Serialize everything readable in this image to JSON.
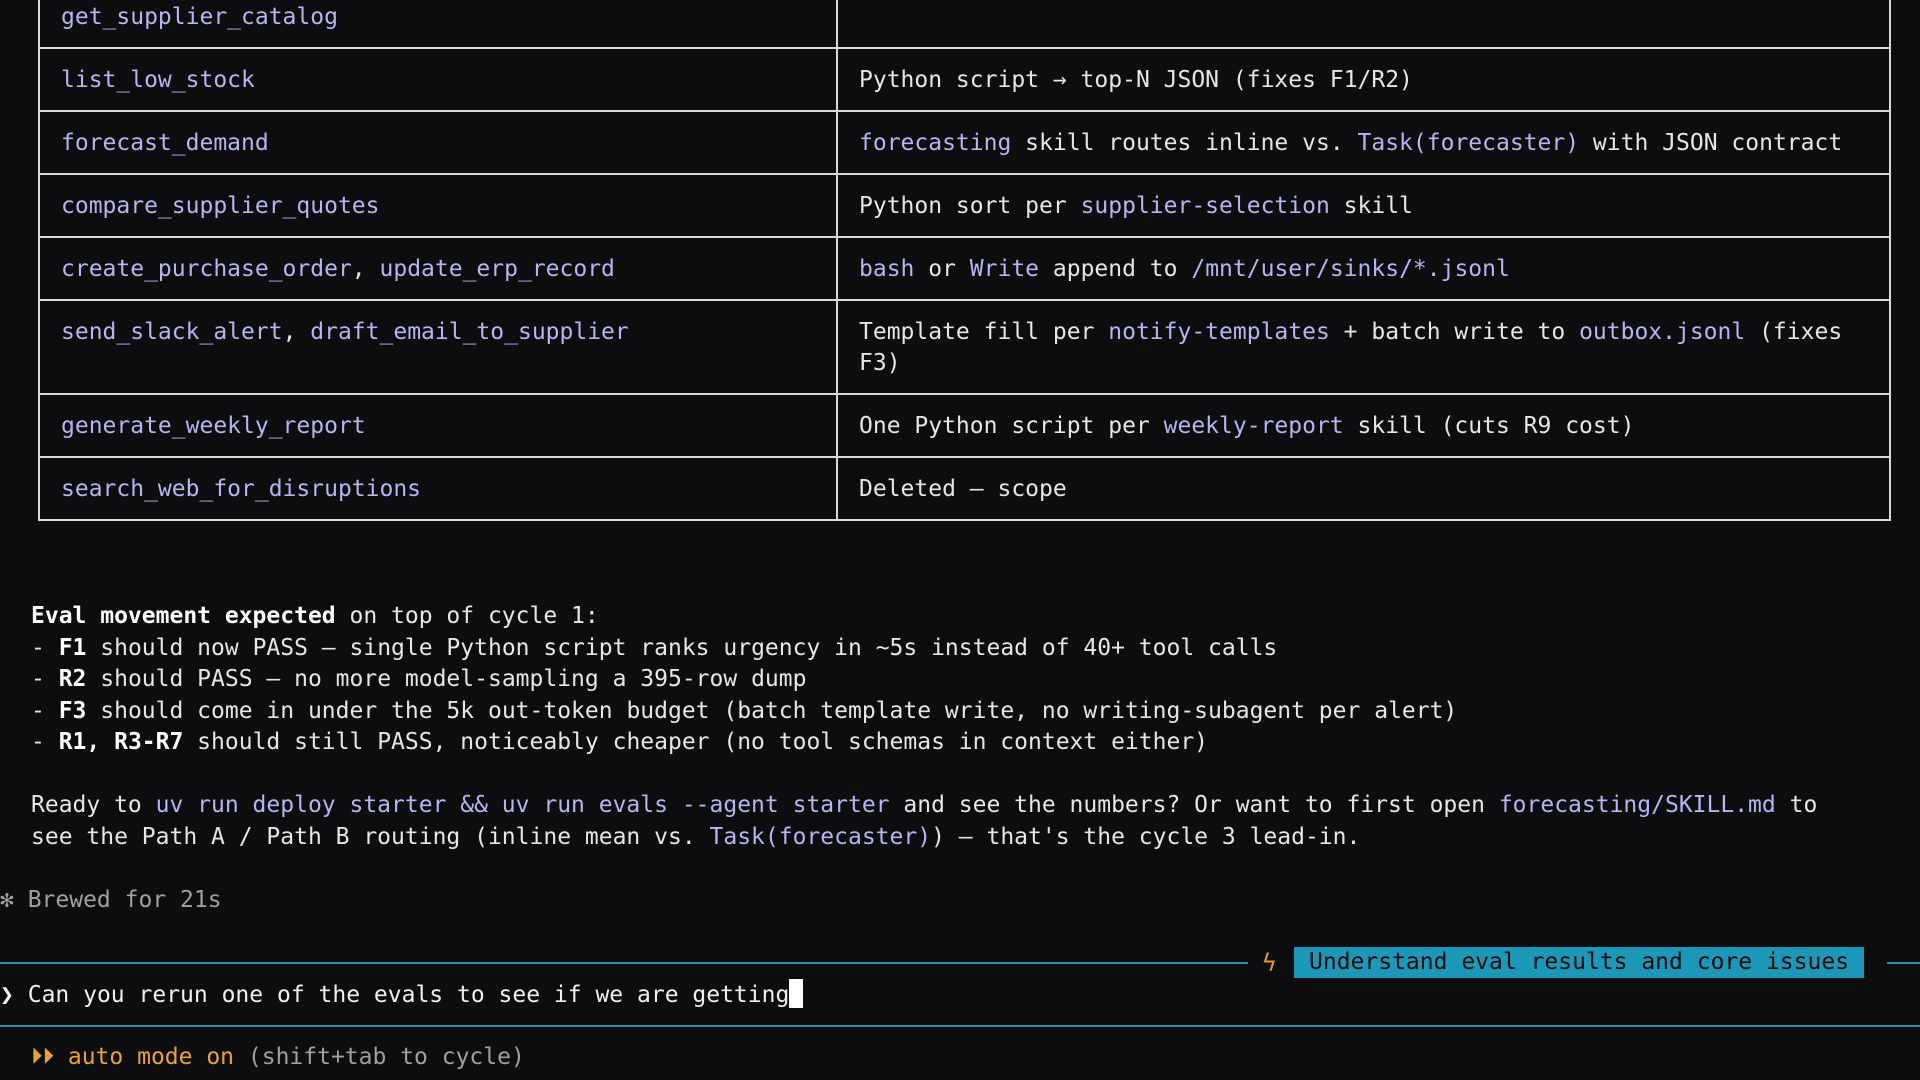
{
  "table": {
    "rows": [
      {
        "tools": [
          "get_supplier_catalog"
        ],
        "replacement": []
      },
      {
        "tools": [
          "list_low_stock"
        ],
        "replacement": [
          {
            "t": "Python script → top-N JSON (fixes F1/R2)"
          }
        ]
      },
      {
        "tools": [
          "forecast_demand"
        ],
        "replacement": [
          {
            "t": "forecasting",
            "code": true
          },
          {
            "t": " skill routes inline vs. "
          },
          {
            "t": "Task(forecaster)",
            "code": true
          },
          {
            "t": " with JSON contract"
          }
        ]
      },
      {
        "tools": [
          "compare_supplier_quotes"
        ],
        "replacement": [
          {
            "t": "Python sort per "
          },
          {
            "t": "supplier-selection",
            "code": true
          },
          {
            "t": " skill"
          }
        ]
      },
      {
        "tools": [
          "create_purchase_order",
          "update_erp_record"
        ],
        "replacement": [
          {
            "t": "bash",
            "code": true
          },
          {
            "t": " or "
          },
          {
            "t": "Write",
            "code": true
          },
          {
            "t": " append to "
          },
          {
            "t": "/mnt/user/sinks/*.jsonl",
            "code": true
          }
        ]
      },
      {
        "tools": [
          "send_slack_alert",
          "draft_email_to_supplier"
        ],
        "replacement": [
          {
            "t": "Template fill per "
          },
          {
            "t": "notify-templates",
            "code": true
          },
          {
            "t": " + batch write to "
          },
          {
            "t": "outbox.jsonl",
            "code": true
          },
          {
            "t": " (fixes F3)"
          }
        ]
      },
      {
        "tools": [
          "generate_weekly_report"
        ],
        "replacement": [
          {
            "t": "One Python script per "
          },
          {
            "t": "weekly-report",
            "code": true
          },
          {
            "t": " skill (cuts R9 cost)"
          }
        ]
      },
      {
        "tools": [
          "search_web_for_disruptions"
        ],
        "replacement": [
          {
            "t": "Deleted — scope"
          }
        ]
      }
    ]
  },
  "eval": {
    "heading_bold": "Eval movement expected",
    "heading_rest": " on top of cycle 1:",
    "items": [
      {
        "id": "F1",
        "text": " should now PASS — single Python script ranks urgency in ~5s instead of 40+ tool calls"
      },
      {
        "id": "R2",
        "text": " should PASS — no more model-sampling a 395-row dump"
      },
      {
        "id": "F3",
        "text": " should come in under the 5k out-token budget (batch template write, no writing-subagent per alert)"
      },
      {
        "id": "R1, R3-R7",
        "text": " should still PASS, noticeably cheaper (no tool schemas in context either)"
      }
    ]
  },
  "ready": {
    "line1": [
      {
        "t": "Ready to "
      },
      {
        "t": "uv run deploy starter && uv run evals --agent starter",
        "code": true
      },
      {
        "t": " and see the numbers? Or want to first open "
      },
      {
        "t": "forecasting/SKILL.md",
        "code": true
      },
      {
        "t": " to"
      }
    ],
    "line2": [
      {
        "t": "see the Path A / Path B routing (inline mean vs. "
      },
      {
        "t": "Task(forecaster)",
        "code": true
      },
      {
        "t": ") — that's the cycle 3 lead-in."
      }
    ]
  },
  "status": {
    "brewed": "✻ Brewed for 21s"
  },
  "session": {
    "icon": "lightning-icon",
    "glyph": "ϟ",
    "title": "Understand eval results and core issues"
  },
  "prompt": {
    "chevron": "❯",
    "value": "Can you rerun one of the evals to see if we are getting"
  },
  "mode": {
    "arrows": "⏵⏵",
    "label": "auto mode on",
    "hint": " (shift+tab to cycle)"
  },
  "colors": {
    "accent": "#1d97b8",
    "code": "#b5b5f0",
    "warn": "#e7932e"
  }
}
